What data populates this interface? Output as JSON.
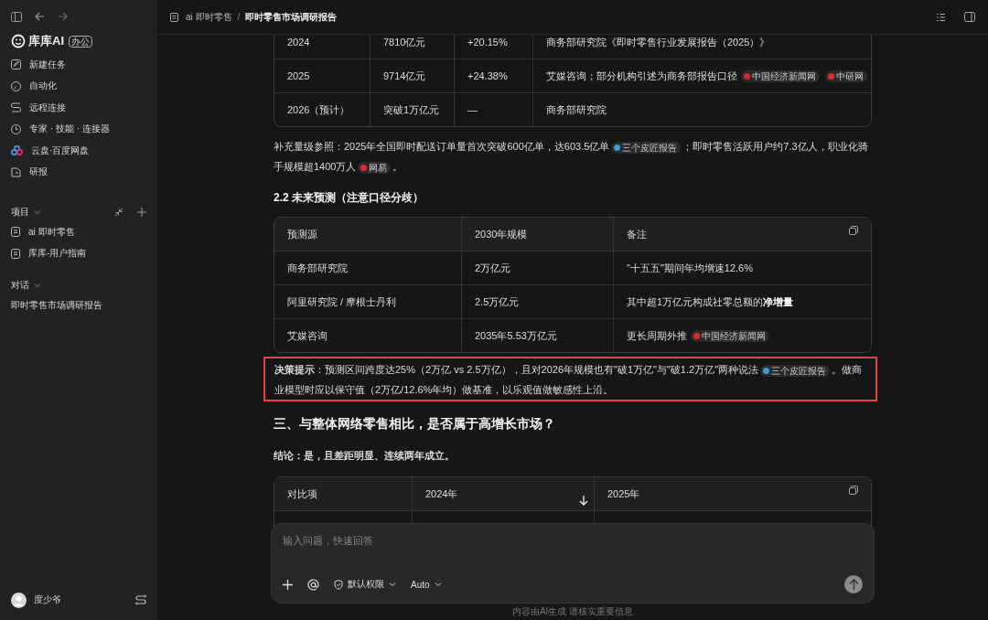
{
  "sidebar": {
    "brand": {
      "name": "库库AI",
      "badge": "办公"
    },
    "nav_items": [
      {
        "label": "新建任务",
        "kind": "edit"
      },
      {
        "label": "自动化",
        "kind": "clock"
      },
      {
        "label": "远程连接",
        "kind": "route"
      },
      {
        "label": "专家 · 技能 · 连接器",
        "kind": "timer"
      },
      {
        "label": "云盘·百度网盘",
        "kind": "cloud"
      },
      {
        "label": "研报",
        "kind": "report"
      }
    ],
    "projects": {
      "title": "项目",
      "expanded": true,
      "items": [
        {
          "label": "ai 即时零售"
        },
        {
          "label": "库库-用户指南"
        }
      ]
    },
    "conversations": {
      "title": "对话",
      "expanded": true,
      "items": [
        {
          "label": "即时零售市场调研报告"
        }
      ]
    },
    "user": {
      "name": "度少爷"
    }
  },
  "breadcrumb": {
    "parent": "ai 即时零售",
    "separator": "/",
    "current": "即时零售市场调研报告"
  },
  "document": [
    {
      "kind": "table",
      "rows": [
        [
          {
            "text": "2024"
          },
          {
            "text": "7810亿元"
          },
          {
            "text": "+20.15%"
          },
          {
            "text": "商务部研究院《即时零售行业发展报告（2025）》"
          }
        ],
        [
          {
            "text": "2025"
          },
          {
            "text": "9714亿元"
          },
          {
            "text": "+24.38%"
          },
          {
            "text": "艾媒咨询；部分机构引述为商务部报告口径",
            "chips": [
              {
                "text": "中国经济新闻网",
                "color": "#d92b2b"
              },
              {
                "text": "中研网",
                "color": "#d92b2b"
              }
            ]
          }
        ],
        [
          {
            "text": "2026（预计）"
          },
          {
            "text": "突破1万亿元"
          },
          {
            "text": "—"
          },
          {
            "text": "商务部研究院"
          }
        ]
      ]
    },
    {
      "kind": "paragraph",
      "segments": [
        {
          "kind": "text",
          "text": "补充量级参照：2025年全国即时配送订单量首次突破600亿单，达603.5亿单"
        },
        {
          "kind": "chip",
          "text": "三个皮匠报告",
          "color": "#3a9fd6"
        },
        {
          "kind": "text",
          "text": "；即时零售活跃用户约7.3亿人，职业化骑手规模超1400万人"
        },
        {
          "kind": "chip",
          "text": "网易",
          "color": "#d92b2b"
        },
        {
          "kind": "text",
          "text": "。"
        }
      ]
    },
    {
      "kind": "subheading",
      "text": "2.2 未来预测（注意口径分歧）"
    },
    {
      "kind": "table",
      "columns": [
        "预测源",
        "2030年规模",
        "备注"
      ],
      "rows": [
        [
          {
            "text": "商务部研究院"
          },
          {
            "text": "2万亿元"
          },
          {
            "text": "\"十五五\"期间年均增速12.6%"
          }
        ],
        [
          {
            "text": "阿里研究院 / 摩根士丹利"
          },
          {
            "text": "2.5万亿元"
          },
          {
            "text": "其中超1万亿元构成社零总额的**净增量**"
          }
        ],
        [
          {
            "text": "艾媒咨询"
          },
          {
            "text": "2035年5.53万亿元"
          },
          {
            "text": "更长周期外推",
            "chips": [
              {
                "text": "中国经济新闻网",
                "color": "#d92b2b"
              }
            ]
          }
        ]
      ]
    },
    {
      "kind": "callout",
      "segments": [
        {
          "kind": "text",
          "text": "**决策提示**：预测区间跨度达25%（2万亿 vs 2.5万亿），且对2026年规模也有\"破1万亿\"与\"破1.2万亿\"两种说法"
        },
        {
          "kind": "chip",
          "text": "三个皮匠报告",
          "color": "#3a9fd6"
        },
        {
          "kind": "text",
          "text": "。做商业模型时应以保守值（2万亿/12.6%年均）做基准，以乐观值做敏感性上沿。"
        }
      ]
    },
    {
      "kind": "heading",
      "text": "三、与整体网络零售相比，是否属于高增长市场？"
    },
    {
      "kind": "paragraph",
      "segments": [
        {
          "kind": "text",
          "text": "**结论：是，且差距明显、连续两年成立。**"
        }
      ]
    },
    {
      "kind": "table",
      "columns": [
        "对比项",
        "2024年",
        "2025年"
      ]
    }
  ],
  "composer": {
    "placeholder": "输入问题，快速回答",
    "permission": "默认权限",
    "model": "Auto"
  },
  "footnote": "内容由AI生成 请核实重要信息"
}
